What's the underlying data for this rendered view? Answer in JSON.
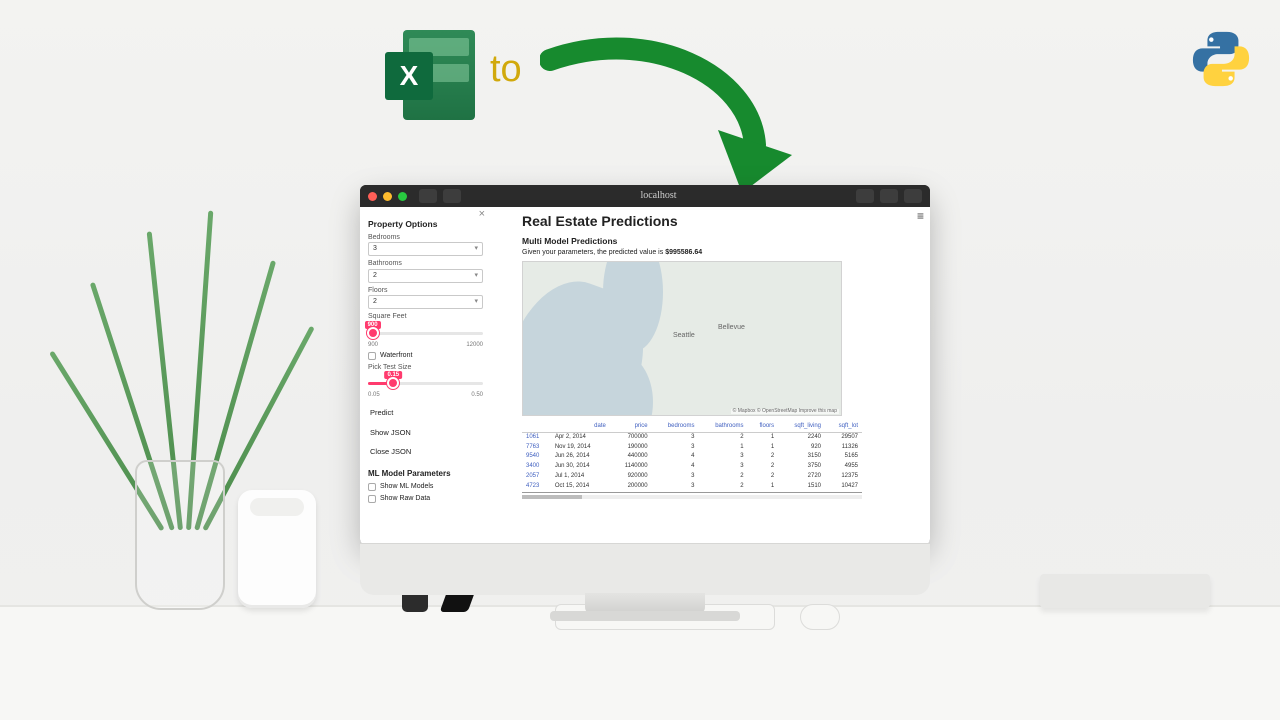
{
  "scene": {
    "to_label": "to"
  },
  "window": {
    "title": "localhost",
    "traffic": {
      "close": "close",
      "min": "minimize",
      "max": "maximize"
    }
  },
  "sidebar": {
    "close_label": "×",
    "title": "Property Options",
    "fields": {
      "bedrooms": {
        "label": "Bedrooms",
        "value": "3"
      },
      "bathrooms": {
        "label": "Bathrooms",
        "value": "2"
      },
      "floors": {
        "label": "Floors",
        "value": "2"
      }
    },
    "sqft": {
      "label": "Square Feet",
      "min": "900",
      "max": "12000",
      "value": "900",
      "value_pct": 4
    },
    "waterfront": {
      "label": "Waterfront",
      "checked": false
    },
    "testsize": {
      "label": "Pick Test Size",
      "min": "0.05",
      "max": "0.50",
      "value": "0.15",
      "value_pct": 22
    },
    "buttons": {
      "predict": "Predict",
      "show_json": "Show JSON",
      "close_json": "Close JSON"
    },
    "ml_section_title": "ML Model Parameters",
    "show_models": {
      "label": "Show ML Models",
      "checked": false
    },
    "show_raw": {
      "label": "Show Raw Data",
      "checked": false
    }
  },
  "main": {
    "title": "Real Estate Predictions",
    "subtitle": "Multi Model Predictions",
    "prediction_prefix": "Given your parameters, the predicted value is ",
    "prediction_value": "$995586.64",
    "map": {
      "city1": "Seattle",
      "city2": "Bellevue",
      "attribution": "© Mapbox © OpenStreetMap  Improve this map"
    },
    "table": {
      "headers": [
        "",
        "date",
        "price",
        "bedrooms",
        "bathrooms",
        "floors",
        "sqft_living",
        "sqft_lot"
      ],
      "rows": [
        [
          "1061",
          "Apr 2, 2014",
          "700000",
          "3",
          "2",
          "1",
          "2240",
          "29507"
        ],
        [
          "7763",
          "Nov 19, 2014",
          "190000",
          "3",
          "1",
          "1",
          "920",
          "11326"
        ],
        [
          "9540",
          "Jun 26, 2014",
          "440000",
          "4",
          "3",
          "2",
          "3150",
          "5165"
        ],
        [
          "3400",
          "Jun 30, 2014",
          "1140000",
          "4",
          "3",
          "2",
          "3750",
          "4955"
        ],
        [
          "2057",
          "Jul 1, 2014",
          "920000",
          "3",
          "2",
          "2",
          "2720",
          "12375"
        ],
        [
          "4723",
          "Oct 15, 2014",
          "200000",
          "3",
          "2",
          "1",
          "1510",
          "10427"
        ]
      ]
    }
  }
}
